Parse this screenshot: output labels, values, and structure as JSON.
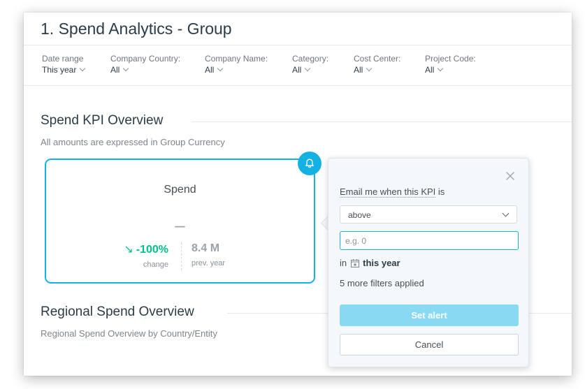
{
  "dashboard": {
    "title": "1. Spend Analytics - Group"
  },
  "filters": [
    {
      "label": "Date range",
      "value": "This year"
    },
    {
      "label": "Company Country:",
      "value": "All"
    },
    {
      "label": "Company Name:",
      "value": "All"
    },
    {
      "label": "Category:",
      "value": "All"
    },
    {
      "label": "Cost Center:",
      "value": "All"
    },
    {
      "label": "Project Code:",
      "value": "All"
    }
  ],
  "kpi_section": {
    "title": "Spend KPI Overview",
    "subtitle": "All amounts are expressed in Group Currency"
  },
  "kpi_card": {
    "title": "Spend",
    "value": "–",
    "change_arrow": "↘",
    "change_value": "-100%",
    "change_label": "change",
    "prev_value": "8.4 M",
    "prev_label": "prev. year"
  },
  "regional_section": {
    "title": "Regional Spend Overview",
    "subtitle": "Regional Spend Overview by Country/Entity"
  },
  "alert_popover": {
    "label_prefix": "Email me when this KPI",
    "label_suffix": " is",
    "condition_selected": "above",
    "threshold_placeholder": "e.g. 0",
    "threshold_value": "",
    "period_prefix": "in",
    "period_value": "this year",
    "filters_note": "5 more filters applied",
    "set_alert_label": "Set alert",
    "cancel_label": "Cancel"
  },
  "colors": {
    "accent": "#14b2e2",
    "positive_change": "#00c18d",
    "set_alert_disabled": "#88daf2"
  },
  "icons": {
    "bell": "bell-icon",
    "close": "close-icon",
    "calendar": "calendar-icon"
  }
}
